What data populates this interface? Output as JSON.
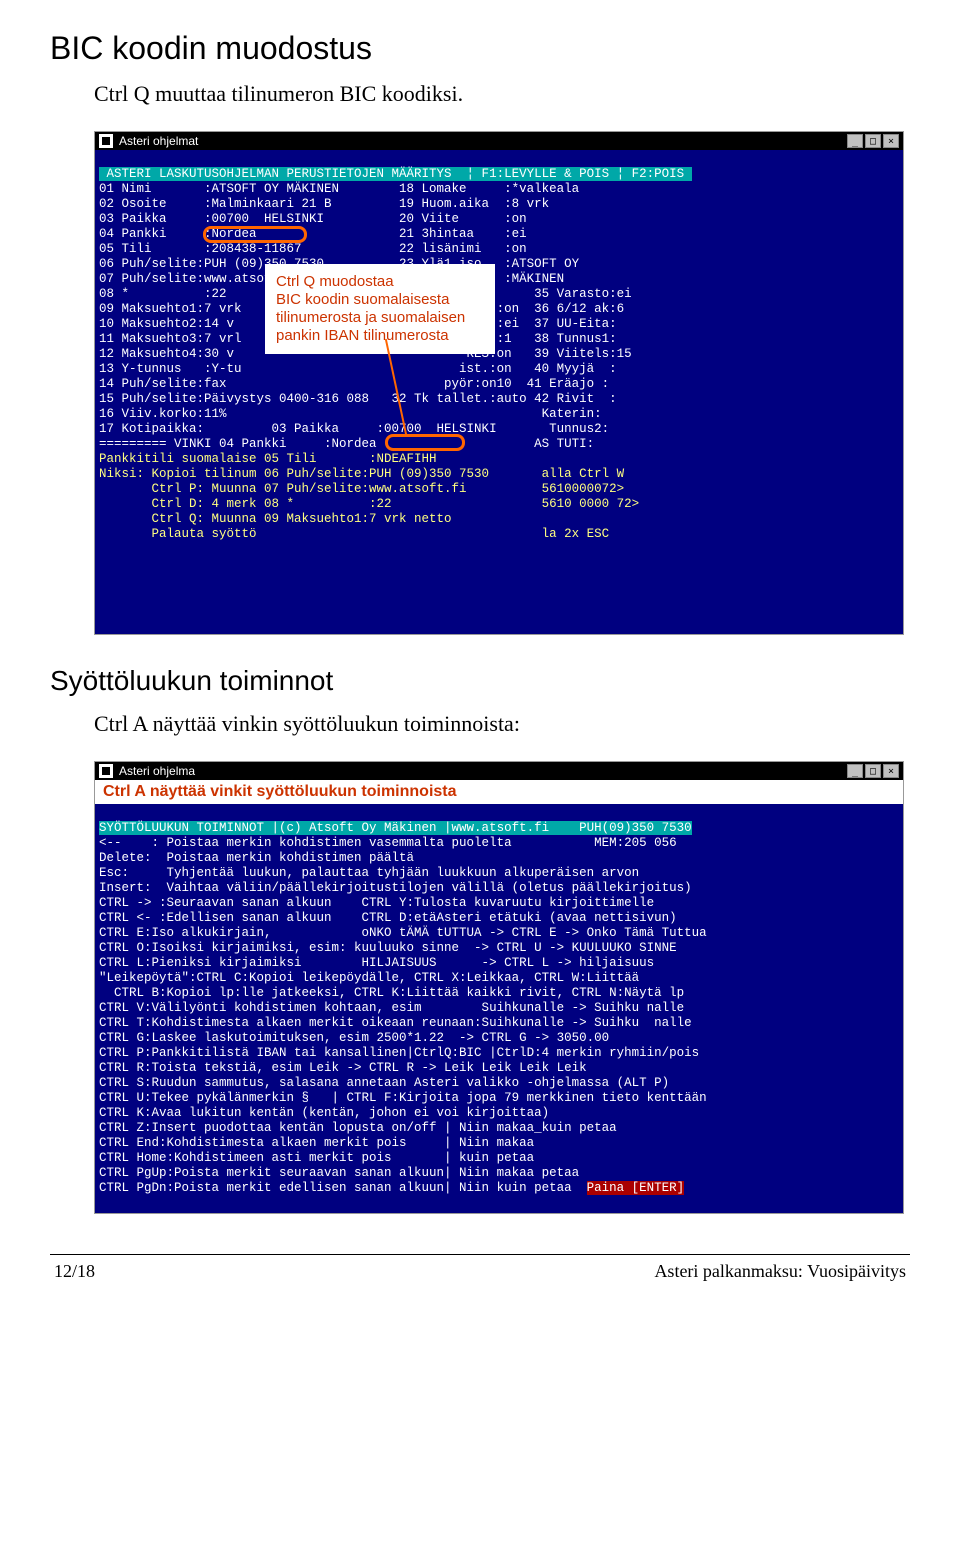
{
  "heading1": "BIC koodin muodostus",
  "paragraph1": "Ctrl Q muuttaa tilinumeron BIC koodiksi.",
  "heading2": "Syöttöluukun toiminnot",
  "paragraph2": "Ctrl A näyttää vinkin syöttöluukun toiminnoista:",
  "window1": {
    "title": "Asteri ohjelmat",
    "header": " ASTERI LASKUTUSOHJELMAN PERUSTIETOJEN MÄÄRITYS  ¦ F1:LEVYLLE & POIS ¦ F2:POIS ",
    "lines": [
      "01 Nimi       :ATSOFT OY MÄKINEN        18 Lomake     :*valkeala",
      "02 Osoite     :Malminkaari 21 B         19 Huom.aika  :8 vrk",
      "03 Paikka     :00700  HELSINKI          20 Viite      :on",
      "04 Pankki     :Nordea                   21 3hintaa    :ei",
      "05 Tili       :208438-11867             22 lisänimi   :on",
      "06 Puh/selite:PUH (09)350 7530          23 Ylä1 iso   :ATSOFT OY",
      "07 Puh/selite:www.atsoft.fi             24 Ylä2 iso   :MÄKINEN",
      "08 *          :22                                   :     35 Varasto:ei",
      "09 Maksuehto1:7 vrk                              aus :on  36 6/12 ak:6",
      "10 Maksuehto2:14 v                               ana :ei  37 UU-Eita:",
      "11 Maksuehto3:7 vrl                              ita :1   38 Tunnus1:",
      "12 Maksuehto4:30 v                               RES:on   39 Viitels:15",
      "13 Y-tunnus   :Y-tu                             ist.:on   40 Myyjä  :",
      "14 Puh/selite:fax                             pyör:on10  41 Eräajo :",
      "15 Puh/selite:Päivystys 0400-316 088   32 Tk tallet.:auto 42 Rivit  :",
      "16 Viiv.korko:11%                                          Katerin:",
      "17 Kotipaikka:         03 Paikka     :00700  HELSINKI       Tunnus2:",
      "========= VINKI 04 Pankki     :Nordea                     AS TUTI:",
      "Pankkitili suomalaise 05 Tili       :NDEAFIHH",
      "Niksi: Kopioi tilinum 06 Puh/selite:PUH (09)350 7530       alla Ctrl W",
      "       Ctrl P: Muunna 07 Puh/selite:www.atsoft.fi          5610000072>",
      "       Ctrl D: 4 merk 08 *          :22                    5610 0000 72>",
      "       Ctrl Q: Muunna 09 Maksuehto1:7 vrk netto",
      "       Palauta syöttö                                      la 2x ESC"
    ],
    "callout": "Ctrl Q muodostaa\nBIC koodin suomalaisesta\ntilinumerosta ja suomalaisen\npankin IBAN tilinumerosta"
  },
  "window2": {
    "title": "Asteri ohjelma",
    "banner": "Ctrl A näyttää vinkit syöttöluukun toiminnoista",
    "header": "SYÖTTÖLUUKUN TOIMINNOT |(c) Atsoft Oy Mäkinen |www.atsoft.fi    PUH(09)350 7530",
    "lines": [
      "<--    : Poistaa merkin kohdistimen vasemmalta puolelta           MEM:205 056",
      "Delete:  Poistaa merkin kohdistimen päältä",
      "Esc:     Tyhjentää luukun, palauttaa tyhjään luukkuun alkuperäisen arvon",
      "Insert:  Vaihtaa väliin/päällekirjoitustilojen välillä (oletus päällekirjoitus)",
      "CTRL -> :Seuraavan sanan alkuun    CTRL Y:Tulosta kuvaruutu kirjoittimelle",
      "CTRL <- :Edellisen sanan alkuun    CTRL D:etäAsteri etätuki (avaa nettisivun)",
      "CTRL E:Iso alkukirjain,            oNKO tÄMÄ tUTTUA -> CTRL E -> Onko Tämä Tuttua",
      "CTRL O:Isoiksi kirjaimiksi, esim: kuuluuko sinne  -> CTRL U -> KUULUUKO SINNE",
      "CTRL L:Pieniksi kirjaimiksi        HILJAISUUS      -> CTRL L -> hiljaisuus",
      "\"Leikepöytä\":CTRL C:Kopioi leikepöydälle, CTRL X:Leikkaa, CTRL W:Liittää",
      "  CTRL B:Kopioi lp:lle jatkeeksi, CTRL K:Liittää kaikki rivit, CTRL N:Näytä lp",
      "CTRL V:Välilyönti kohdistimen kohtaan, esim        Suihkunalle -> Suihku nalle",
      "CTRL T:Kohdistimesta alkaen merkit oikeaan reunaan:Suihkunalle -> Suihku  nalle",
      "CTRL G:Laskee laskutoimituksen, esim 2500*1.22  -> CTRL G -> 3050.00",
      "CTRL P:Pankkitilistä IBAN tai kansallinen|CtrlQ:BIC |CtrlD:4 merkin ryhmiin/pois",
      "CTRL R:Toista tekstiä, esim Leik -> CTRL R -> Leik Leik Leik Leik",
      "CTRL S:Ruudun sammutus, salasana annetaan Asteri valikko -ohjelmassa (ALT P)",
      "CTRL U:Tekee pykälänmerkin §   | CTRL F:Kirjoita jopa 79 merkkinen tieto kenttään",
      "CTRL K:Avaa lukitun kentän (kentän, johon ei voi kirjoittaa)",
      "CTRL Z:Insert puodottaa kentän lopusta on/off | Niin makaa_kuin petaa",
      "CTRL End:Kohdistimesta alkaen merkit pois     | Niin makaa",
      "CTRL Home:Kohdistimeen asti merkit pois       | kuin petaa",
      "CTRL PgUp:Poista merkit seuraavan sanan alkuun| Niin makaa petaa",
      "CTRL PgDn:Poista merkit edellisen sanan alkuun| Niin kuin petaa  "
    ],
    "paina": "Paina [ENTER]"
  },
  "footer": {
    "left": "12/18",
    "right": "Asteri palkanmaksu: Vuosipäivitys"
  }
}
